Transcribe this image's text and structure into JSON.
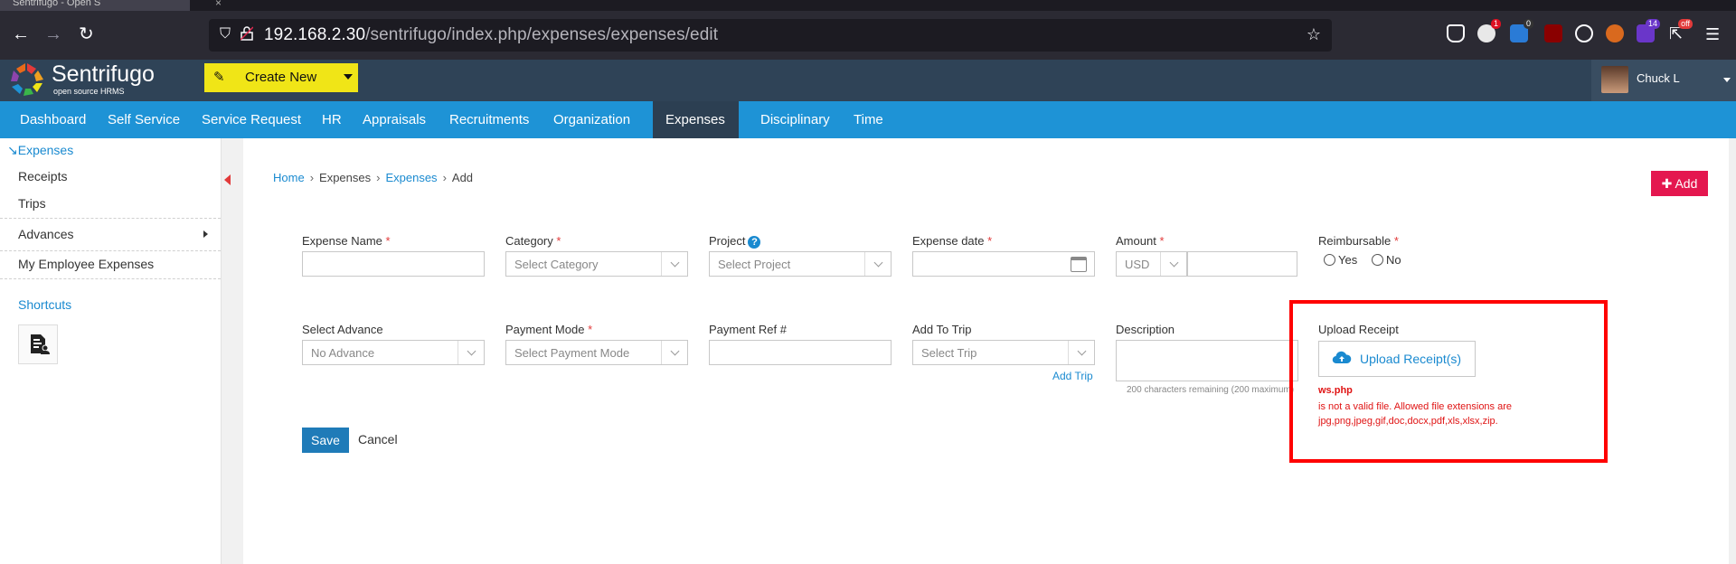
{
  "browser": {
    "tab_title": "Sentrifugo - Open S",
    "url_host": "192.168.2.30",
    "url_path": "/sentrifugo/index.php/expenses/expenses/edit",
    "ext_badges": [
      "1",
      "0",
      "14",
      "off"
    ]
  },
  "header": {
    "logo_name": "Sentrifugo",
    "logo_sub": "open source HRMS",
    "create_new": "Create New",
    "user_name": "Chuck L"
  },
  "menu": {
    "items": [
      "Dashboard",
      "Self Service",
      "Service Request",
      "HR",
      "Appraisals",
      "Recruitments",
      "Organization",
      "Expenses",
      "Disciplinary",
      "Time"
    ],
    "active": "Expenses"
  },
  "sidebar": {
    "head": "Expenses",
    "items": [
      "Receipts",
      "Trips",
      "Advances",
      "My Employee Expenses"
    ],
    "shortcuts": "Shortcuts"
  },
  "breadcrumb": [
    "Home",
    "Expenses",
    "Expenses",
    "Add"
  ],
  "add_button": "Add",
  "form": {
    "expense_name": "Expense Name",
    "category": "Category",
    "category_placeholder": "Select Category",
    "project": "Project",
    "project_placeholder": "Select Project",
    "expense_date": "Expense date",
    "amount": "Amount",
    "currency": "USD",
    "reimbursable": "Reimbursable",
    "yes": "Yes",
    "no": "No",
    "select_advance": "Select Advance",
    "advance_value": "No Advance",
    "payment_mode": "Payment Mode",
    "payment_mode_placeholder": "Select Payment Mode",
    "payment_ref": "Payment Ref #",
    "add_to_trip": "Add To Trip",
    "trip_placeholder": "Select Trip",
    "add_trip_link": "Add Trip",
    "description": "Description",
    "description_hint": "200 characters remaining (200 maximum)",
    "upload_receipt": "Upload Receipt",
    "upload_button": "Upload Receipt(s)",
    "error_file": "ws.php",
    "error_line1": "is not a valid file. Allowed file extensions are",
    "error_line2": "jpg,png,jpeg,gif,doc,docx,pdf,xls,xlsx,zip.",
    "save": "Save",
    "cancel": "Cancel"
  },
  "colors": {
    "menu_bar": "#1e93d6",
    "header_bg": "#2f4357",
    "create_button": "#f0e517",
    "add_button": "#e4174f",
    "error": "#e01414"
  }
}
